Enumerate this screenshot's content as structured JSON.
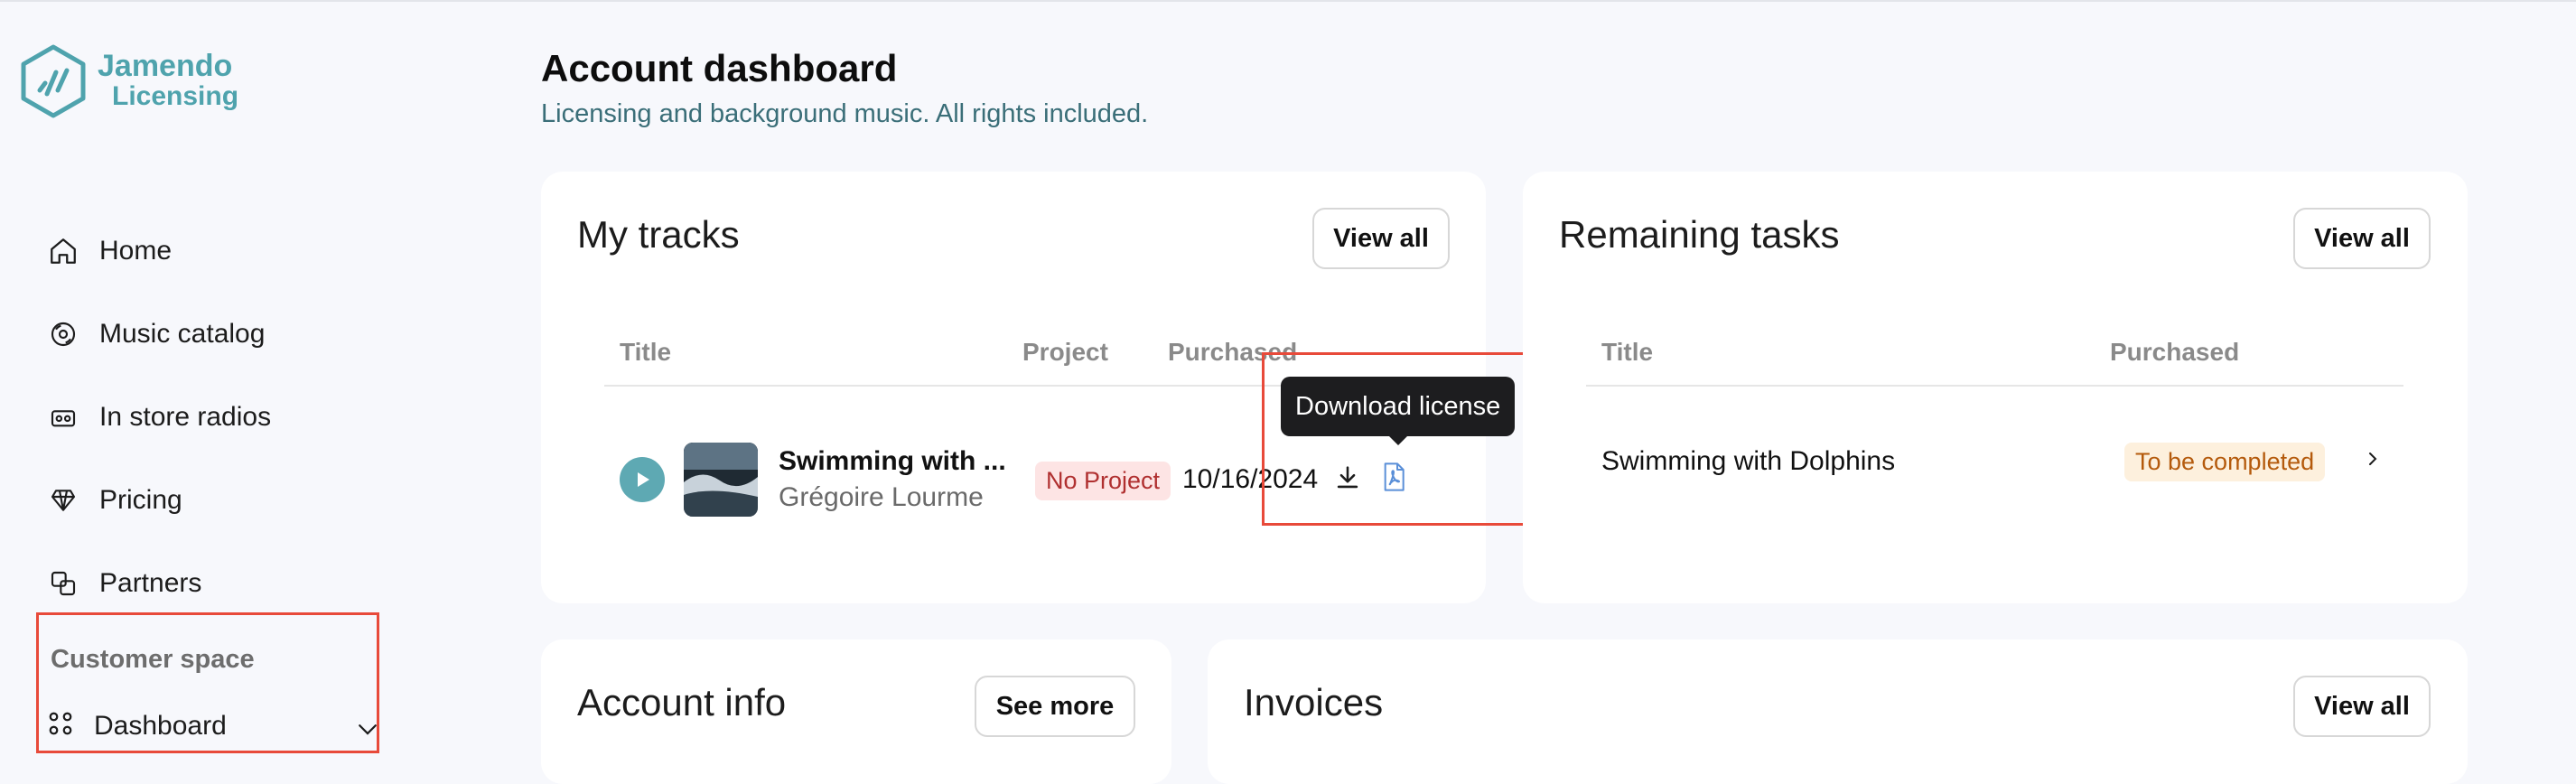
{
  "brand": {
    "name_line1": "Jamendo",
    "name_line2": "Licensing",
    "color": "#4fa3ad"
  },
  "sidebar": {
    "items": [
      {
        "label": "Home",
        "icon": "home-icon"
      },
      {
        "label": "Music catalog",
        "icon": "music-catalog-icon"
      },
      {
        "label": "In store radios",
        "icon": "radio-icon"
      },
      {
        "label": "Pricing",
        "icon": "diamond-icon"
      },
      {
        "label": "Partners",
        "icon": "partners-icon"
      }
    ],
    "section_label": "Customer space",
    "dashboard_label": "Dashboard"
  },
  "header": {
    "title": "Account dashboard",
    "subtitle": "Licensing and background music. All rights included."
  },
  "my_tracks": {
    "title": "My tracks",
    "view_all": "View all",
    "columns": {
      "title": "Title",
      "project": "Project",
      "purchased": "Purchased"
    },
    "row": {
      "title": "Swimming with ...",
      "artist": "Grégoire Lourme",
      "project": "No Project",
      "date": "10/16/2024"
    },
    "tooltip": "Download license"
  },
  "remaining_tasks": {
    "title": "Remaining tasks",
    "view_all": "View all",
    "columns": {
      "title": "Title",
      "purchased": "Purchased"
    },
    "row": {
      "title": "Swimming with Dolphins",
      "status": "To be completed"
    }
  },
  "account_info": {
    "title": "Account info",
    "see_more": "See more"
  },
  "invoices": {
    "title": "Invoices",
    "view_all": "View all"
  }
}
